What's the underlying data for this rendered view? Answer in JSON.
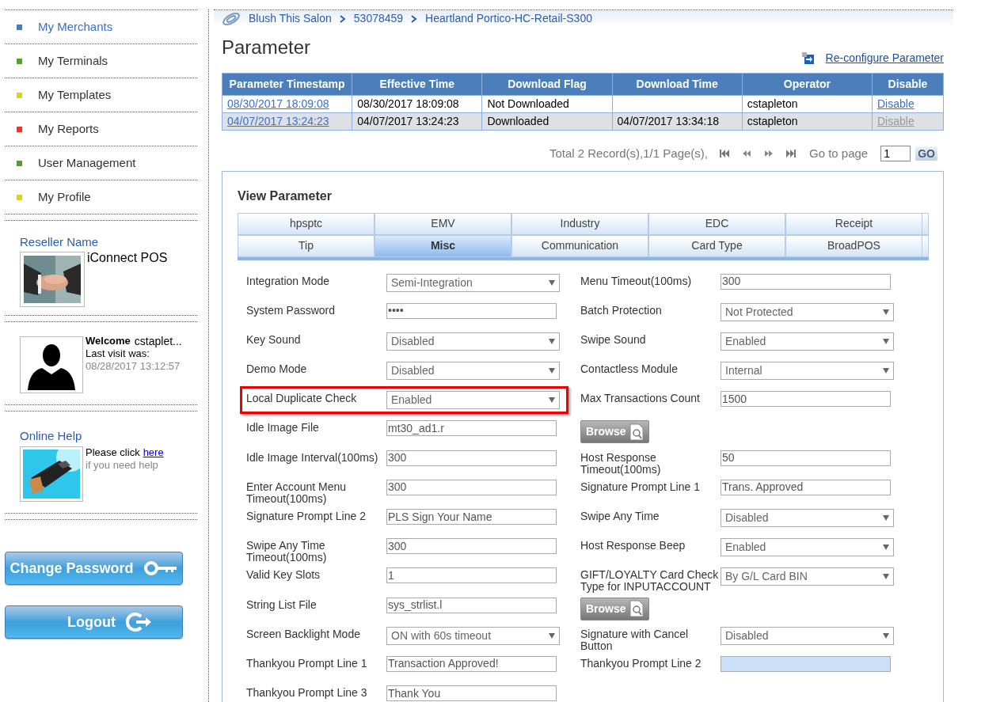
{
  "sidebar": {
    "nav": [
      {
        "label": "My Merchants",
        "color": "#3a7fd5",
        "selected": true
      },
      {
        "label": "My Terminals",
        "color": "#4ea51c",
        "selected": false
      },
      {
        "label": "My Templates",
        "color": "#e3d20f",
        "selected": false
      },
      {
        "label": "My Reports",
        "color": "#f2312a",
        "selected": false
      },
      {
        "label": "User Management",
        "color": "#4ea51c",
        "selected": false
      },
      {
        "label": "My Profile",
        "color": "#e3d20f",
        "selected": false
      }
    ],
    "reseller": {
      "title": "Reseller Name",
      "name": "iConnect POS"
    },
    "user": {
      "welcome": "Welcome",
      "username": "cstaplet...",
      "last_visit_label": "Last visit was:",
      "last_visit": "08/28/2017 13:12:57"
    },
    "help": {
      "title": "Online Help",
      "text": "Please click",
      "link": "here",
      "subtext": "if you need help"
    },
    "buttons": [
      "Change Password",
      "Logout"
    ]
  },
  "breadcrumb": [
    "Blush This Salon",
    "53078459",
    "Heartland Portico-HC-Retail-S300"
  ],
  "page_title": "Parameter",
  "reconfigure_link": "Re-configure Parameter",
  "table": {
    "columns": [
      "Parameter Timestamp",
      "Effective Time",
      "Download Flag",
      "Download Time",
      "Operator",
      "Disable"
    ],
    "rows": [
      {
        "timestamp": "08/30/2017 18:09:08",
        "effective": "08/30/2017 18:09:08",
        "flag": "Not Downloaded",
        "operator": "cstapleton",
        "disable": "Disable",
        "disable_disabled": false
      },
      {
        "timestamp": "04/07/2017 13:24:23",
        "effective": "04/07/2017 13:24:23",
        "flag": "Downloaded",
        "download_time": "04/07/2017 13:34:18",
        "operator": "cstapleton",
        "disable": "Disable",
        "disable_disabled": true
      }
    ]
  },
  "pagination": {
    "summary": "Total 2 Record(s),1/1 Page(s),",
    "goto_label": "Go to page",
    "page": "1",
    "go": "GO"
  },
  "view": {
    "title": "View Parameter",
    "tabs": [
      [
        {
          "label": "hpsptc",
          "selected": false
        },
        {
          "label": "EMV",
          "selected": false
        },
        {
          "label": "Industry",
          "selected": false
        },
        {
          "label": "EDC",
          "selected": false
        },
        {
          "label": "Receipt",
          "selected": false
        }
      ],
      [
        {
          "label": "Tip",
          "selected": false
        },
        {
          "label": "Misc",
          "selected": true
        },
        {
          "label": "Communication",
          "selected": false
        },
        {
          "label": "Card Type",
          "selected": false
        },
        {
          "label": "BroadPOS",
          "selected": false
        }
      ]
    ],
    "rows": [
      [
        {
          "kind": "select",
          "label": "Integration Mode",
          "value": "Semi-Integration"
        },
        {
          "kind": "text",
          "label": "Menu Timeout(100ms)",
          "value": "300"
        }
      ],
      [
        {
          "kind": "text",
          "label": "System Password",
          "value": "••••"
        },
        {
          "kind": "select",
          "label": "Batch Protection",
          "value": "Not Protected"
        }
      ],
      [
        {
          "kind": "select",
          "label": "Key Sound",
          "value": "Disabled"
        },
        {
          "kind": "select",
          "label": "Swipe Sound",
          "value": "Enabled"
        }
      ],
      [
        {
          "kind": "select",
          "label": "Demo Mode",
          "value": "Disabled"
        },
        {
          "kind": "select",
          "label": "Contactless Module",
          "value": "Internal"
        }
      ],
      [
        {
          "kind": "select",
          "label": "Local Duplicate Check",
          "value": "Enabled",
          "highlighted": true
        },
        {
          "kind": "text",
          "label": "Max Transactions Count",
          "value": "1500"
        }
      ],
      [
        {
          "kind": "text",
          "label": "Idle Image File",
          "value": "mt30_ad1.r"
        },
        {
          "kind": "browse",
          "label": "Browse"
        }
      ],
      [
        {
          "kind": "text",
          "label": "Idle Image Interval(100ms)",
          "value": "300"
        },
        {
          "kind": "text",
          "label": "Host Response Timeout(100ms)",
          "value": "50"
        }
      ],
      [
        {
          "kind": "text",
          "label": "Enter Account Menu Timeout(100ms)",
          "value": "300"
        },
        {
          "kind": "text",
          "label": "Signature Prompt Line 1",
          "value": "Trans. Approved"
        }
      ],
      [
        {
          "kind": "text",
          "label": "Signature Prompt Line 2",
          "value": "PLS Sign Your Name"
        },
        {
          "kind": "select",
          "label": "Swipe Any Time",
          "value": "Disabled"
        }
      ],
      [
        {
          "kind": "text",
          "label": "Swipe Any Time Timeout(100ms)",
          "value": "300"
        },
        {
          "kind": "select",
          "label": "Host Response Beep",
          "value": "Enabled"
        }
      ],
      [
        {
          "kind": "text",
          "label": "Valid Key Slots",
          "value": "1"
        },
        {
          "kind": "select",
          "label": "GIFT/LOYALTY Card Check Type for INPUTACCOUNT",
          "value": "By G/L Card BIN"
        }
      ],
      [
        {
          "kind": "text",
          "label": "String List File",
          "value": "sys_strlist.l"
        },
        {
          "kind": "browse",
          "label": "Browse"
        }
      ],
      [
        {
          "kind": "select",
          "label": "Screen Backlight Mode",
          "value": "ON with 60s timeout"
        },
        {
          "kind": "select",
          "label": "Signature with Cancel Button",
          "value": "Disabled"
        }
      ],
      [
        {
          "kind": "text",
          "label": "Thankyou Prompt Line 1",
          "value": "Transaction Approved!"
        },
        {
          "kind": "text",
          "label": "Thankyou Prompt Line 2",
          "focused": true
        }
      ],
      [
        {
          "kind": "text",
          "label": "Thankyou Prompt Line 3",
          "value": "Thank You"
        }
      ]
    ]
  }
}
